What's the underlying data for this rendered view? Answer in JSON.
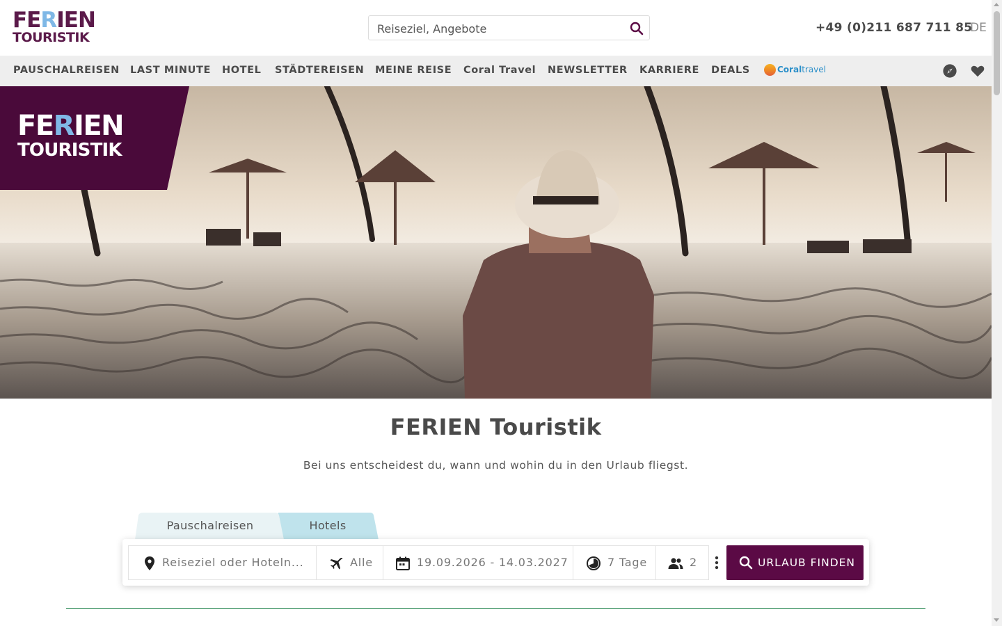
{
  "header": {
    "logo_line1": "FERIEN",
    "logo_line2": "TOURISTIK",
    "search_placeholder": "Reiseziel, Angebote",
    "phone": "+49 (0)211 687 711 85",
    "language": "DE"
  },
  "nav": {
    "items": [
      {
        "label": "PAUSCHALREISEN"
      },
      {
        "label": "LAST MINUTE"
      },
      {
        "label": "HOTEL"
      },
      {
        "label": "STÄDTEREISEN"
      },
      {
        "label": "MEINE REISE"
      },
      {
        "label": "Coral Travel"
      },
      {
        "label": "NEWSLETTER"
      },
      {
        "label": "KARRIERE"
      },
      {
        "label": "DEALS"
      }
    ],
    "partner_logo_text_1": "Coral",
    "partner_logo_text_2": "travel",
    "icons": [
      "compass-icon",
      "heart-icon"
    ]
  },
  "hero": {
    "badge_line1": "FERIEN",
    "badge_line2": "TOURISTIK"
  },
  "main": {
    "title": "FERIEN Touristik",
    "subtitle": "Bei uns entscheidest du, wann und wohin du in den Urlaub fliegst."
  },
  "search_form": {
    "tabs": [
      {
        "label": "Pauschalreisen",
        "active": true
      },
      {
        "label": "Hotels",
        "active": false
      }
    ],
    "destination_placeholder": "Reiseziel oder Hoteln...",
    "airport": "Alle",
    "dates": "19.09.2026 - 14.03.2027",
    "duration": "7 Tage",
    "travellers": "2",
    "submit_label": "URLAUB FINDEN"
  },
  "colors": {
    "brand": "#5b0a45",
    "brand_logo": "#5b1a4a",
    "accent_blue": "#7fb8e6",
    "tab_inactive": "#bfe3ec",
    "divider": "#2e8b57"
  }
}
